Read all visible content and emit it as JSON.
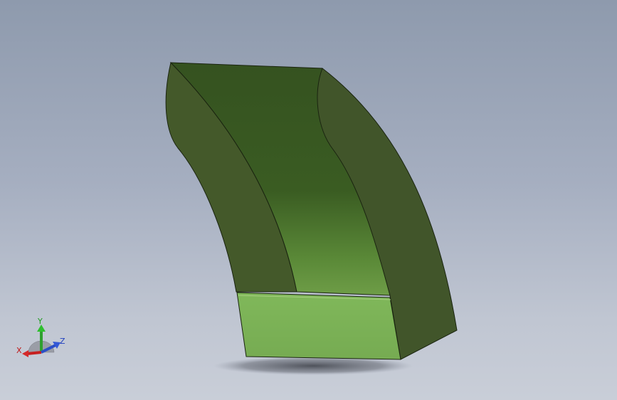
{
  "viewport": {
    "background_top": "#8e9aad",
    "background_bottom": "#c9ced8"
  },
  "model": {
    "face_colors": {
      "left_side": "#44592a",
      "top_face": "#35541f",
      "right_side": "#41552a",
      "front_face": "#7db358",
      "edges": "#1a2410"
    }
  },
  "triad": {
    "x_label": "X",
    "y_label": "Y",
    "z_label": "Z",
    "x_color": "#c01818",
    "y_color": "#1d9b1d",
    "z_color": "#1f3fbf"
  }
}
